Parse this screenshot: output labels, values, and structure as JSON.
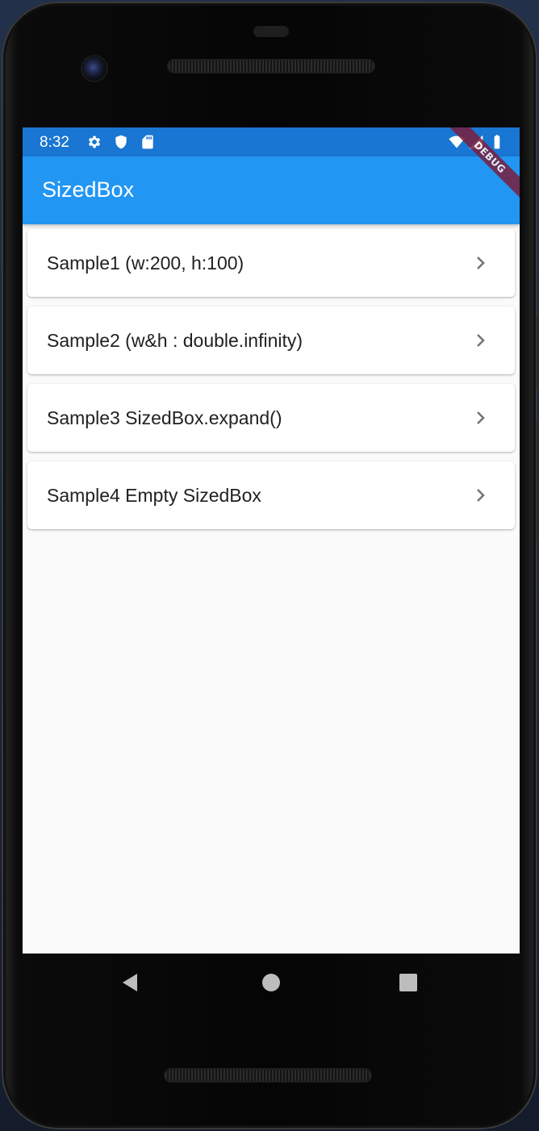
{
  "status_bar": {
    "time": "8:32",
    "left_icons": [
      "gear-icon",
      "shield-icon",
      "sd-card-icon"
    ],
    "right_icons": [
      "wifi-icon",
      "signal-icon",
      "battery-icon"
    ]
  },
  "debug_banner": "DEBUG",
  "app_bar": {
    "title": "SizedBox",
    "color": "#2196f3",
    "status_color": "#1976d2"
  },
  "list": {
    "items": [
      {
        "label": "Sample1 (w:200, h:100)",
        "icon": "chevron-right-icon"
      },
      {
        "label": "Sample2 (w&h : double.infinity)",
        "icon": "chevron-right-icon"
      },
      {
        "label": "Sample3 SizedBox.expand()",
        "icon": "chevron-right-icon"
      },
      {
        "label": "Sample4 Empty SizedBox",
        "icon": "chevron-right-icon"
      }
    ]
  },
  "nav_bar": {
    "buttons": [
      "back-icon",
      "home-icon",
      "recents-icon"
    ]
  }
}
